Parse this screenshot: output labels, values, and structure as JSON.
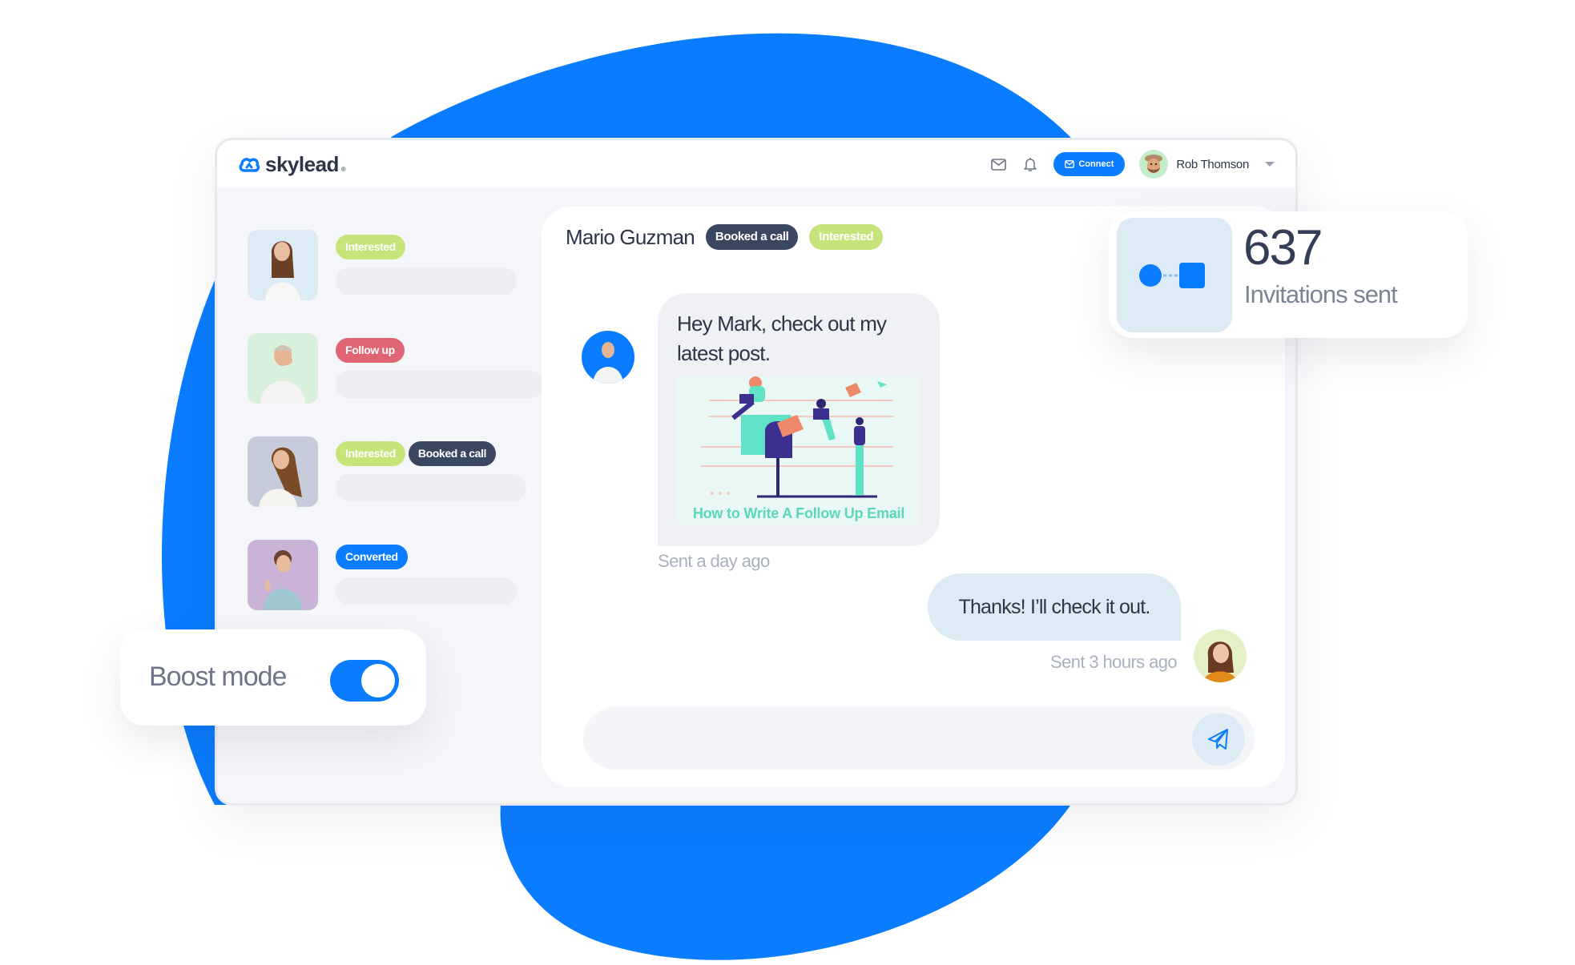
{
  "colors": {
    "brand_blue": "#0a7cff",
    "interested": "#c5e57b",
    "follow_up": "#e06574",
    "booked": "#3b4760",
    "converted": "#0a7cff"
  },
  "app": {
    "logo_text": "skylead",
    "logo_icon": "cloud-link-icon"
  },
  "topbar": {
    "mail_icon": "envelope-icon",
    "notifications_icon": "bell-icon",
    "connect_label": "Connect",
    "user_name": "Rob Thomson"
  },
  "leads": [
    {
      "tags": [
        {
          "label": "Interested",
          "type": "interested"
        }
      ]
    },
    {
      "tags": [
        {
          "label": "Follow up",
          "type": "followup"
        }
      ]
    },
    {
      "tags": [
        {
          "label": "Interested",
          "type": "interested"
        },
        {
          "label": "Booked a call",
          "type": "booked"
        }
      ]
    },
    {
      "tags": [
        {
          "label": "Converted",
          "type": "converted"
        }
      ]
    }
  ],
  "conversation": {
    "contact_name": "Mario Guzman",
    "tags": [
      {
        "label": "Booked a call",
        "type": "booked"
      },
      {
        "label": "Interested",
        "type": "interested"
      }
    ],
    "messages": [
      {
        "direction": "incoming",
        "text": "Hey Mark, check out my latest post.",
        "attachment_title": "How to Write A Follow Up Email",
        "time": "Sent a day ago"
      },
      {
        "direction": "outgoing",
        "text": "Thanks! I’ll check it out.",
        "time": "Sent 3 hours ago"
      }
    ],
    "composer_placeholder": "",
    "send_icon": "paper-plane-icon"
  },
  "stats": {
    "value": "637",
    "label": "Invitations sent"
  },
  "boost": {
    "label": "Boost mode",
    "enabled": true
  }
}
